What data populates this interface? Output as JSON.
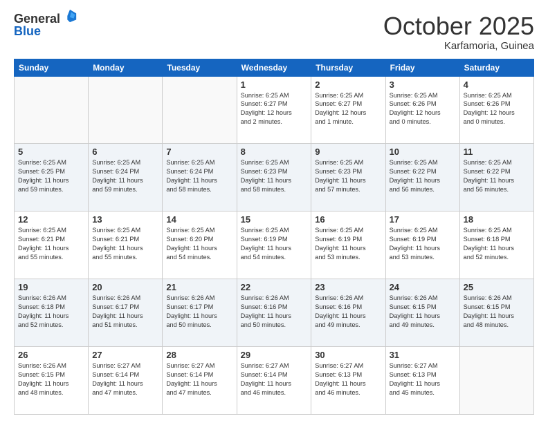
{
  "logo": {
    "general": "General",
    "blue": "Blue"
  },
  "title": "October 2025",
  "location": "Karfamoria, Guinea",
  "weekdays": [
    "Sunday",
    "Monday",
    "Tuesday",
    "Wednesday",
    "Thursday",
    "Friday",
    "Saturday"
  ],
  "weeks": [
    [
      {
        "day": "",
        "info": ""
      },
      {
        "day": "",
        "info": ""
      },
      {
        "day": "",
        "info": ""
      },
      {
        "day": "1",
        "info": "Sunrise: 6:25 AM\nSunset: 6:27 PM\nDaylight: 12 hours\nand 2 minutes."
      },
      {
        "day": "2",
        "info": "Sunrise: 6:25 AM\nSunset: 6:27 PM\nDaylight: 12 hours\nand 1 minute."
      },
      {
        "day": "3",
        "info": "Sunrise: 6:25 AM\nSunset: 6:26 PM\nDaylight: 12 hours\nand 0 minutes."
      },
      {
        "day": "4",
        "info": "Sunrise: 6:25 AM\nSunset: 6:26 PM\nDaylight: 12 hours\nand 0 minutes."
      }
    ],
    [
      {
        "day": "5",
        "info": "Sunrise: 6:25 AM\nSunset: 6:25 PM\nDaylight: 11 hours\nand 59 minutes."
      },
      {
        "day": "6",
        "info": "Sunrise: 6:25 AM\nSunset: 6:24 PM\nDaylight: 11 hours\nand 59 minutes."
      },
      {
        "day": "7",
        "info": "Sunrise: 6:25 AM\nSunset: 6:24 PM\nDaylight: 11 hours\nand 58 minutes."
      },
      {
        "day": "8",
        "info": "Sunrise: 6:25 AM\nSunset: 6:23 PM\nDaylight: 11 hours\nand 58 minutes."
      },
      {
        "day": "9",
        "info": "Sunrise: 6:25 AM\nSunset: 6:23 PM\nDaylight: 11 hours\nand 57 minutes."
      },
      {
        "day": "10",
        "info": "Sunrise: 6:25 AM\nSunset: 6:22 PM\nDaylight: 11 hours\nand 56 minutes."
      },
      {
        "day": "11",
        "info": "Sunrise: 6:25 AM\nSunset: 6:22 PM\nDaylight: 11 hours\nand 56 minutes."
      }
    ],
    [
      {
        "day": "12",
        "info": "Sunrise: 6:25 AM\nSunset: 6:21 PM\nDaylight: 11 hours\nand 55 minutes."
      },
      {
        "day": "13",
        "info": "Sunrise: 6:25 AM\nSunset: 6:21 PM\nDaylight: 11 hours\nand 55 minutes."
      },
      {
        "day": "14",
        "info": "Sunrise: 6:25 AM\nSunset: 6:20 PM\nDaylight: 11 hours\nand 54 minutes."
      },
      {
        "day": "15",
        "info": "Sunrise: 6:25 AM\nSunset: 6:19 PM\nDaylight: 11 hours\nand 54 minutes."
      },
      {
        "day": "16",
        "info": "Sunrise: 6:25 AM\nSunset: 6:19 PM\nDaylight: 11 hours\nand 53 minutes."
      },
      {
        "day": "17",
        "info": "Sunrise: 6:25 AM\nSunset: 6:19 PM\nDaylight: 11 hours\nand 53 minutes."
      },
      {
        "day": "18",
        "info": "Sunrise: 6:25 AM\nSunset: 6:18 PM\nDaylight: 11 hours\nand 52 minutes."
      }
    ],
    [
      {
        "day": "19",
        "info": "Sunrise: 6:26 AM\nSunset: 6:18 PM\nDaylight: 11 hours\nand 52 minutes."
      },
      {
        "day": "20",
        "info": "Sunrise: 6:26 AM\nSunset: 6:17 PM\nDaylight: 11 hours\nand 51 minutes."
      },
      {
        "day": "21",
        "info": "Sunrise: 6:26 AM\nSunset: 6:17 PM\nDaylight: 11 hours\nand 50 minutes."
      },
      {
        "day": "22",
        "info": "Sunrise: 6:26 AM\nSunset: 6:16 PM\nDaylight: 11 hours\nand 50 minutes."
      },
      {
        "day": "23",
        "info": "Sunrise: 6:26 AM\nSunset: 6:16 PM\nDaylight: 11 hours\nand 49 minutes."
      },
      {
        "day": "24",
        "info": "Sunrise: 6:26 AM\nSunset: 6:15 PM\nDaylight: 11 hours\nand 49 minutes."
      },
      {
        "day": "25",
        "info": "Sunrise: 6:26 AM\nSunset: 6:15 PM\nDaylight: 11 hours\nand 48 minutes."
      }
    ],
    [
      {
        "day": "26",
        "info": "Sunrise: 6:26 AM\nSunset: 6:15 PM\nDaylight: 11 hours\nand 48 minutes."
      },
      {
        "day": "27",
        "info": "Sunrise: 6:27 AM\nSunset: 6:14 PM\nDaylight: 11 hours\nand 47 minutes."
      },
      {
        "day": "28",
        "info": "Sunrise: 6:27 AM\nSunset: 6:14 PM\nDaylight: 11 hours\nand 47 minutes."
      },
      {
        "day": "29",
        "info": "Sunrise: 6:27 AM\nSunset: 6:14 PM\nDaylight: 11 hours\nand 46 minutes."
      },
      {
        "day": "30",
        "info": "Sunrise: 6:27 AM\nSunset: 6:13 PM\nDaylight: 11 hours\nand 46 minutes."
      },
      {
        "day": "31",
        "info": "Sunrise: 6:27 AM\nSunset: 6:13 PM\nDaylight: 11 hours\nand 45 minutes."
      },
      {
        "day": "",
        "info": ""
      }
    ]
  ]
}
